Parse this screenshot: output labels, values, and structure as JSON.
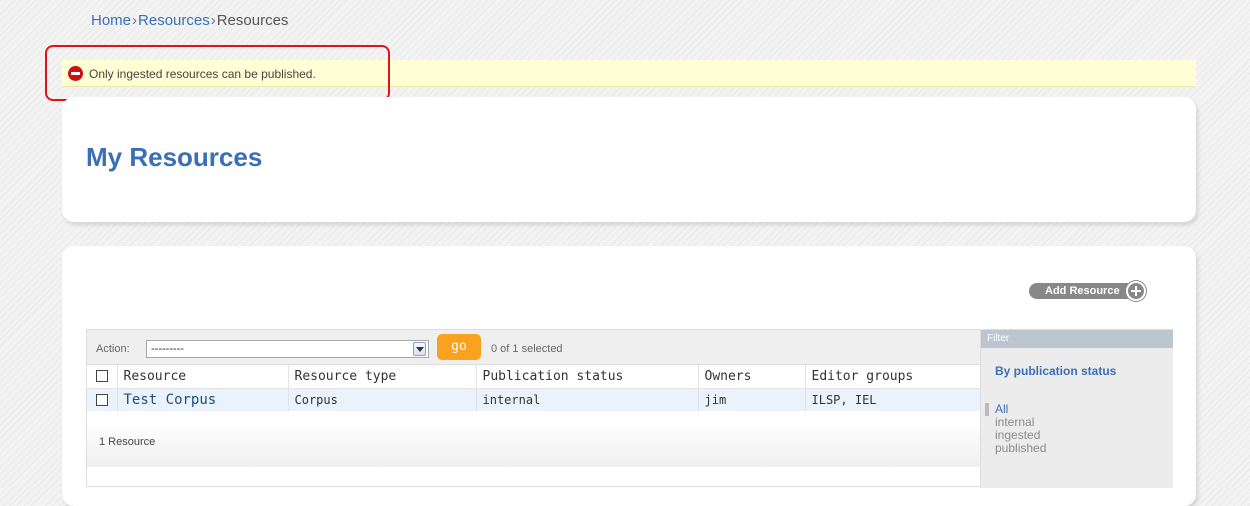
{
  "breadcrumb": {
    "home": "Home",
    "sep": "›",
    "resources": "Resources",
    "current": "Resources"
  },
  "message": {
    "text": "Only ingested resources can be published.",
    "type": "error"
  },
  "page": {
    "title": "My Resources"
  },
  "toolbar": {
    "add_resource": "Add Resource"
  },
  "actions": {
    "label": "Action:",
    "selected_value": "---------",
    "go_label": "go",
    "counter": "0 of 1 selected"
  },
  "table": {
    "headers": [
      "Resource",
      "Resource type",
      "Publication status",
      "Owners",
      "Editor groups"
    ],
    "rows": [
      {
        "resource": "Test Corpus",
        "type": "Corpus",
        "status": "internal",
        "owners": "jim",
        "editor_groups": "ILSP, IEL"
      }
    ]
  },
  "paginator": {
    "text": "1 Resource"
  },
  "filter": {
    "header": "Filter",
    "title": "By publication status",
    "options": [
      "All",
      "internal",
      "ingested",
      "published"
    ],
    "selected": "All"
  },
  "colors": {
    "accent": "#3a6fb5",
    "go_button": "#f9a21f",
    "error": "#cc1111",
    "message_bg": "#ffffd6"
  },
  "icons": {
    "message": "error-icon",
    "add": "plus-icon",
    "select": "chevron-down-icon"
  }
}
